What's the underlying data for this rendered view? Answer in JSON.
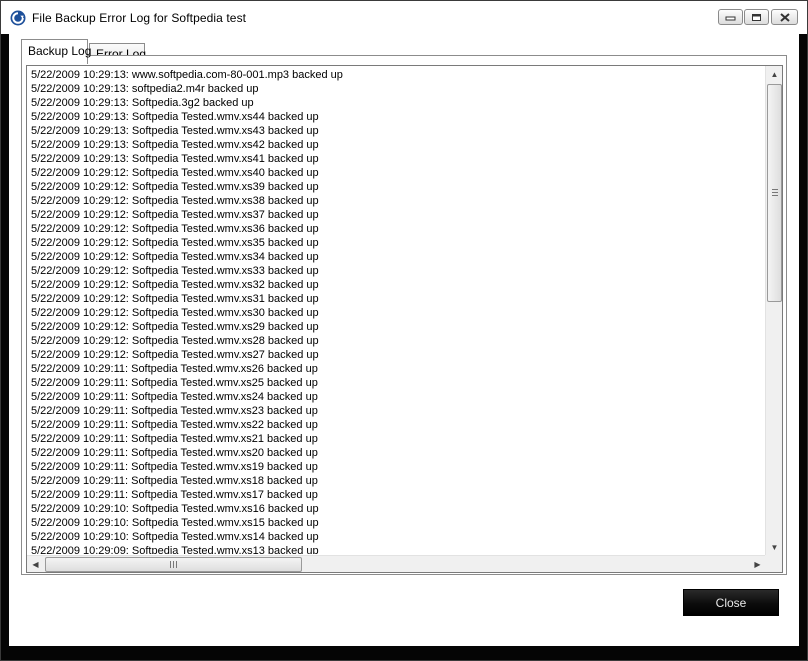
{
  "window": {
    "title": "File Backup Error Log for Softpedia test",
    "icon": "refresh-icon"
  },
  "titlebar_buttons": {
    "minimize_icon": "minimize-icon",
    "maximize_icon": "maximize-icon",
    "close_icon": "close-icon"
  },
  "tabs": [
    {
      "label": "Backup Log",
      "active": true
    },
    {
      "label": "Error Log",
      "active": false
    }
  ],
  "log_lines": [
    "5/22/2009 10:29:13: www.softpedia.com-80-001.mp3 backed up",
    "5/22/2009 10:29:13: softpedia2.m4r backed up",
    "5/22/2009 10:29:13: Softpedia.3g2 backed up",
    "5/22/2009 10:29:13: Softpedia Tested.wmv.xs44 backed up",
    "5/22/2009 10:29:13: Softpedia Tested.wmv.xs43 backed up",
    "5/22/2009 10:29:13: Softpedia Tested.wmv.xs42 backed up",
    "5/22/2009 10:29:13: Softpedia Tested.wmv.xs41 backed up",
    "5/22/2009 10:29:12: Softpedia Tested.wmv.xs40 backed up",
    "5/22/2009 10:29:12: Softpedia Tested.wmv.xs39 backed up",
    "5/22/2009 10:29:12: Softpedia Tested.wmv.xs38 backed up",
    "5/22/2009 10:29:12: Softpedia Tested.wmv.xs37 backed up",
    "5/22/2009 10:29:12: Softpedia Tested.wmv.xs36 backed up",
    "5/22/2009 10:29:12: Softpedia Tested.wmv.xs35 backed up",
    "5/22/2009 10:29:12: Softpedia Tested.wmv.xs34 backed up",
    "5/22/2009 10:29:12: Softpedia Tested.wmv.xs33 backed up",
    "5/22/2009 10:29:12: Softpedia Tested.wmv.xs32 backed up",
    "5/22/2009 10:29:12: Softpedia Tested.wmv.xs31 backed up",
    "5/22/2009 10:29:12: Softpedia Tested.wmv.xs30 backed up",
    "5/22/2009 10:29:12: Softpedia Tested.wmv.xs29 backed up",
    "5/22/2009 10:29:12: Softpedia Tested.wmv.xs28 backed up",
    "5/22/2009 10:29:12: Softpedia Tested.wmv.xs27 backed up",
    "5/22/2009 10:29:11: Softpedia Tested.wmv.xs26 backed up",
    "5/22/2009 10:29:11: Softpedia Tested.wmv.xs25 backed up",
    "5/22/2009 10:29:11: Softpedia Tested.wmv.xs24 backed up",
    "5/22/2009 10:29:11: Softpedia Tested.wmv.xs23 backed up",
    "5/22/2009 10:29:11: Softpedia Tested.wmv.xs22 backed up",
    "5/22/2009 10:29:11: Softpedia Tested.wmv.xs21 backed up",
    "5/22/2009 10:29:11: Softpedia Tested.wmv.xs20 backed up",
    "5/22/2009 10:29:11: Softpedia Tested.wmv.xs19 backed up",
    "5/22/2009 10:29:11: Softpedia Tested.wmv.xs18 backed up",
    "5/22/2009 10:29:11: Softpedia Tested.wmv.xs17 backed up",
    "5/22/2009 10:29:10: Softpedia Tested.wmv.xs16 backed up",
    "5/22/2009 10:29:10: Softpedia Tested.wmv.xs15 backed up",
    "5/22/2009 10:29:10: Softpedia Tested.wmv.xs14 backed up",
    "5/22/2009 10:29:09: Softpedia Tested.wmv.xs13 backed up"
  ],
  "scrollbars": {
    "up_icon": "arrow-up-icon",
    "down_icon": "arrow-down-icon",
    "left_icon": "arrow-left-icon",
    "right_icon": "arrow-right-icon"
  },
  "actions": {
    "close_label": "Close"
  }
}
